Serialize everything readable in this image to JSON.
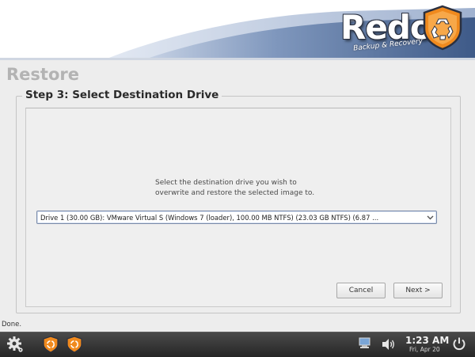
{
  "header": {
    "logo_text": "Redo",
    "logo_subtitle": "Backup & Recovery"
  },
  "page": {
    "title": "Restore",
    "step_title": "Step 3: Select Destination Drive"
  },
  "main": {
    "instruction_line1": "Select the destination drive you wish to",
    "instruction_line2": "overwrite and restore the selected image to.",
    "drive_select": {
      "selected": "Drive 1 (30.00 GB): VMware Virtual S (Windows 7 (loader), 100.00 MB NTFS) (23.03 GB NTFS) (6.87 ..."
    },
    "cancel_label": "Cancel",
    "next_label": "Next >"
  },
  "status": {
    "text": "Done."
  },
  "taskbar": {
    "time": "1:23 AM",
    "date": "Fri, Apr 20",
    "icons": [
      "settings-gear-icon",
      "redo-app-icon",
      "redo-app-icon",
      "network-icon",
      "volume-icon",
      "power-icon"
    ]
  },
  "colors": {
    "brand_orange": "#f08a1e",
    "banner_blue": "#4f6c9a",
    "taskbar_dark": "#2e2e2e"
  }
}
